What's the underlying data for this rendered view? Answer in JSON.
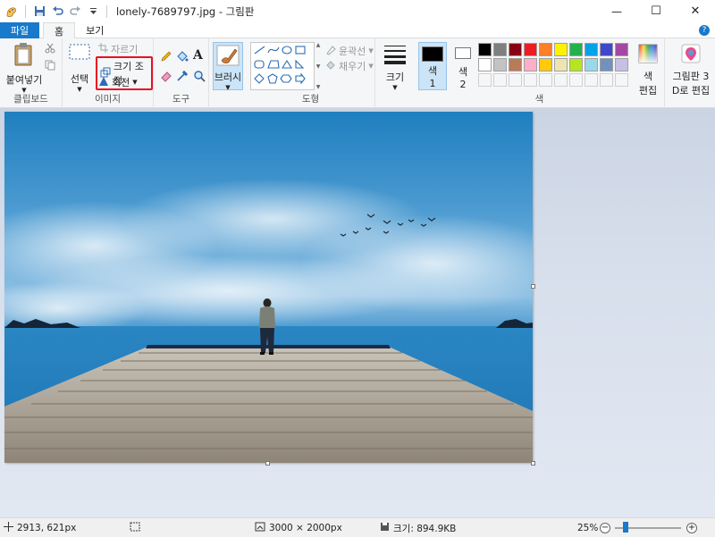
{
  "window": {
    "title": "lonely-7689797.jpg - 그림판",
    "controls": [
      "—",
      "☐",
      "✕"
    ]
  },
  "tabs": [
    {
      "label": "파일"
    },
    {
      "label": "홈"
    },
    {
      "label": "보기"
    }
  ],
  "clipboard": {
    "paste_label": "붙여넣기",
    "group_label": "클립보드"
  },
  "image": {
    "select_label": "선택",
    "crop_label": "자르기",
    "resize_label": "크기 조정",
    "rotate_label": "회전",
    "group_label": "이미지"
  },
  "tools": {
    "group_label": "도구"
  },
  "brushes": {
    "label": "브러시"
  },
  "shapes": {
    "outline_label": "윤곽선",
    "fill_label": "채우기",
    "group_label": "도형"
  },
  "size": {
    "label": "크기"
  },
  "colors": {
    "color1_label": "색",
    "color1_num": "1",
    "color2_label": "색",
    "color2_num": "2",
    "edit_label_1": "색",
    "edit_label_2": "편집",
    "group_label": "색",
    "color1": "#000000",
    "color2": "#ffffff",
    "palette_row1": [
      "#000000",
      "#7f7f7f",
      "#880015",
      "#ed1c24",
      "#ff7f27",
      "#fff200",
      "#22b14c",
      "#00a2e8",
      "#3f48cc",
      "#a349a4"
    ],
    "palette_row2": [
      "#ffffff",
      "#c3c3c3",
      "#b97a57",
      "#ffaec9",
      "#ffc90e",
      "#efe4b0",
      "#b5e61d",
      "#99d9ea",
      "#7092be",
      "#c8bfe7"
    ]
  },
  "paint3d": {
    "label_1": "그림판 3",
    "label_2": "D로 편집"
  },
  "status": {
    "cursor_pos": "2913, 621px",
    "image_size": "3000 × 2000px",
    "file_size": "크기: 894.9KB",
    "zoom": "25%"
  },
  "accent": "#1979ca",
  "highlight": "#e81123"
}
